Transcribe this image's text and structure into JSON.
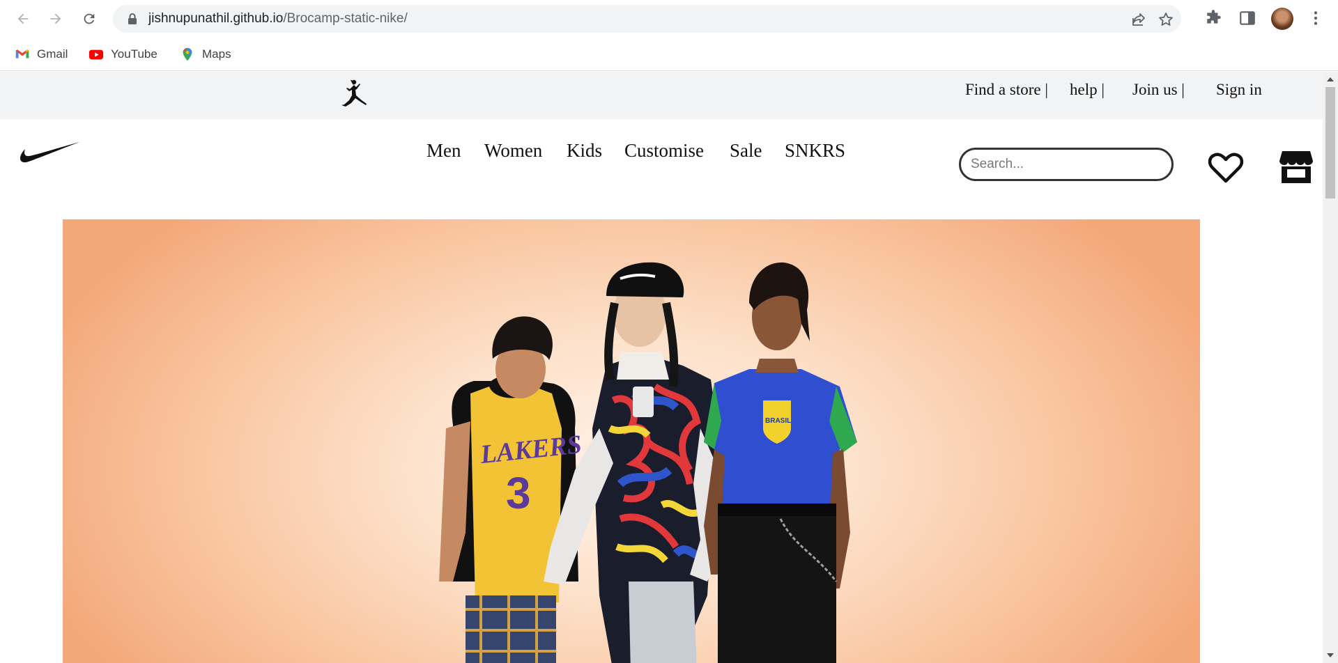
{
  "browser": {
    "url_host": "jishnupunathil.github.io",
    "url_path": "/Brocamp-static-nike/",
    "bookmarks": [
      {
        "label": "Gmail",
        "icon": "gmail-icon"
      },
      {
        "label": "YouTube",
        "icon": "youtube-icon"
      },
      {
        "label": "Maps",
        "icon": "maps-icon"
      }
    ]
  },
  "site": {
    "utility_links": [
      "Find a store |",
      "help |",
      "Join us |",
      "Sign in"
    ],
    "menu": [
      "Men",
      "Women",
      "Kids",
      "Customise",
      "Sale",
      "SNKRS"
    ],
    "search_placeholder": "Search...",
    "icons": {
      "brand_logo": "nike-swoosh-icon",
      "jordan_logo": "jordan-jumpman-icon",
      "favorites": "heart-icon",
      "store": "store-icon"
    },
    "hero": {
      "jersey_text_left": "LAKERS",
      "jersey_number_left": "3",
      "jersey_text_right": "BRASIL"
    }
  },
  "colors": {
    "topbar_bg": "#f1f3f4",
    "hero_peach": "#f9c59f",
    "text": "#111111"
  }
}
